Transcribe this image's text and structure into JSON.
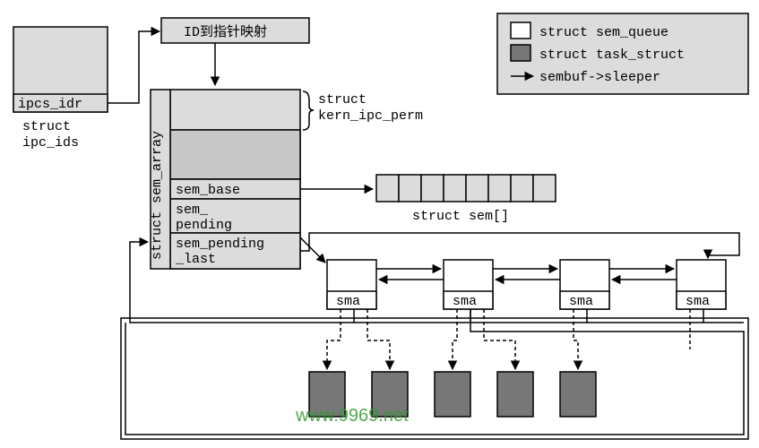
{
  "legend": {
    "sem_queue": "struct sem_queue",
    "task_struct": "struct task_struct",
    "sleeper": "sembuf->sleeper"
  },
  "ipc_ids": {
    "field": "ipcs_idr",
    "label_l1": "struct",
    "label_l2": "ipc_ids"
  },
  "mapping_title": "ID到指针映射",
  "sem_array": {
    "label": "struct sem_array",
    "kern_l1": "struct",
    "kern_l2": "kern_ipc_perm",
    "sem_base": "sem_base",
    "sem_pending_l1": "sem_",
    "sem_pending_l2": "pending",
    "sem_pending_last_l1": "sem_pending",
    "sem_pending_last_l2": "_last"
  },
  "sem_array_label": "struct sem[]",
  "sma": "sma",
  "watermark": "www.9969.net"
}
